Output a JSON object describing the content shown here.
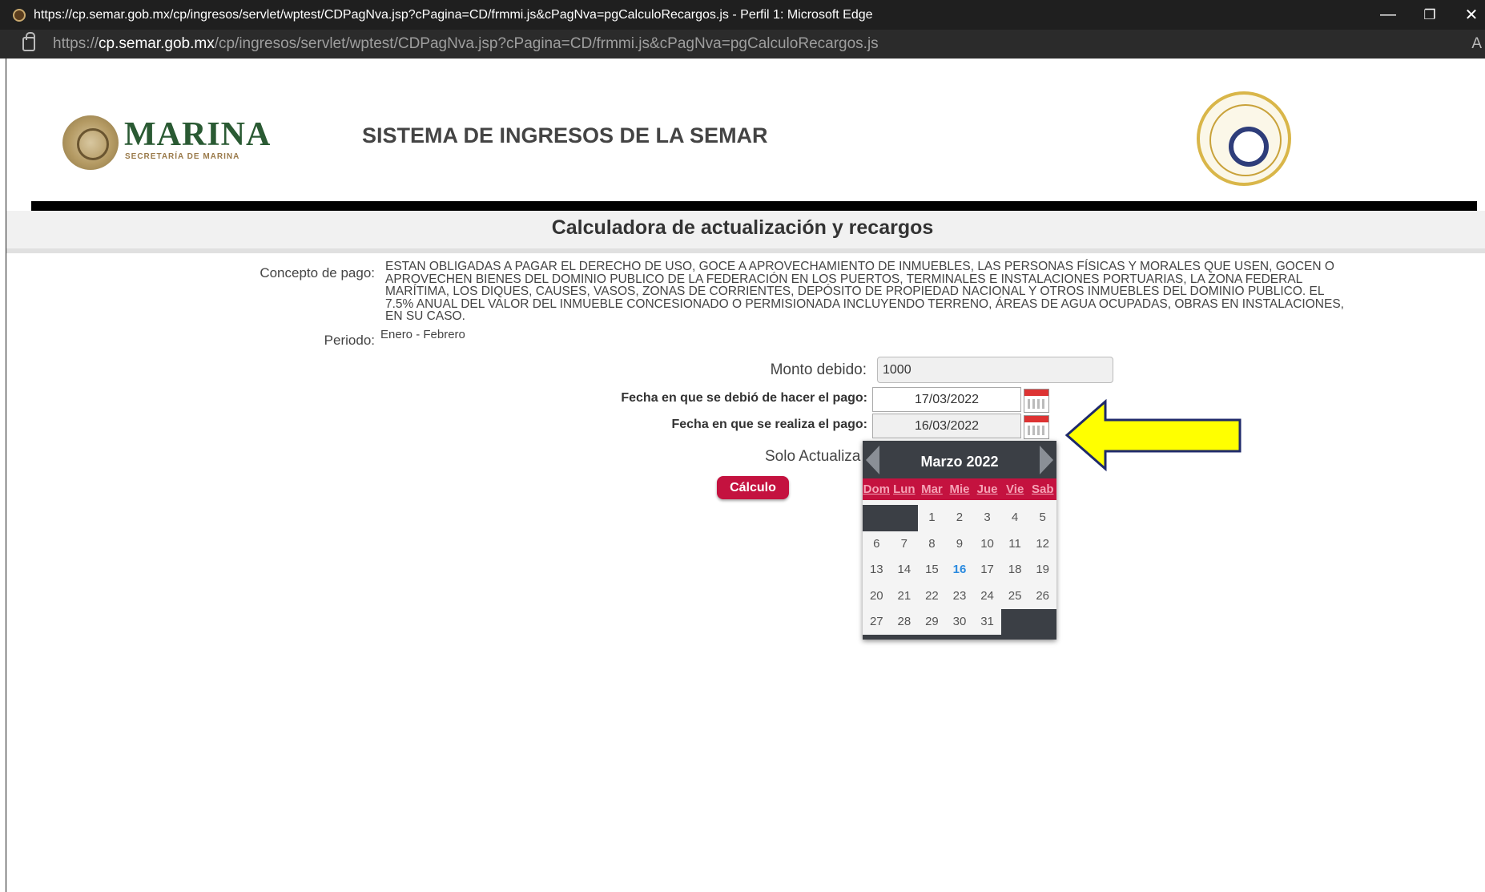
{
  "browser": {
    "window_title": "https://cp.semar.gob.mx/cp/ingresos/servlet/wptest/CDPagNva.jsp?cPagina=CD/frmmi.js&cPagNva=pgCalculoRecargos.js - Perfil 1: Microsoft Edge",
    "url_scheme": "https://",
    "url_host": "cp.semar.gob.mx",
    "url_path": "/cp/ingresos/servlet/wptest/CDPagNva.jsp?cPagina=CD/frmmi.js&cPagNva=pgCalculoRecargos.js",
    "reader_mode": "A",
    "minimize": "—",
    "restore": "❐",
    "close": "✕"
  },
  "header": {
    "brand": "MARINA",
    "brand_sub": "SECRETARÍA DE MARINA",
    "system_title": "SISTEMA DE INGRESOS DE LA SEMAR"
  },
  "page": {
    "title": "Calculadora de actualización y recargos"
  },
  "form": {
    "concepto_label": "Concepto de pago:",
    "concepto_lines": [
      "ESTAN OBLIGADAS A PAGAR EL DERECHO DE USO, GOCE A APROVECHAMIENTO DE INMUEBLES, LAS PERSONAS FÍSICAS Y MORALES QUE USEN, GOCEN O",
      "APROVECHEN BIENES DEL DOMINIO PUBLICO DE LA FEDERACIÓN EN LOS PUERTOS, TERMINALES E INSTALACIONES PORTUARIAS, LA ZONA FEDERAL",
      "MARÍTIMA, LOS DIQUES, CAUSES, VASOS, ZONAS DE CORRIENTES, DEPÓSITO DE PROPIEDAD NACIONAL Y OTROS INMUEBLES DEL DOMINIO PUBLICO. EL",
      "7.5% ANUAL DEL VALOR DEL INMUEBLE CONCESIONADO O PERMISIONADA INCLUYENDO TERRENO, ÁREAS DE AGUA OCUPADAS, OBRAS EN INSTALACIONES,",
      "EN SU CASO."
    ],
    "periodo_label": "Periodo:",
    "periodo_value": "Enero - Febrero",
    "monto_label": "Monto debido:",
    "monto_value": "1000",
    "fecha_debio_label": "Fecha en que se debió de hacer el pago:",
    "fecha_debio_value": "17/03/2022",
    "fecha_realiza_label": "Fecha en que se realiza el pago:",
    "fecha_realiza_value": "16/03/2022",
    "solo_label": "Solo Actualiza",
    "calculo_button": "Cálculo"
  },
  "calendar": {
    "month": "Marzo",
    "year": "2022",
    "weekdays": [
      "Dom",
      "Lun",
      "Mar",
      "Mie",
      "Jue",
      "Vie",
      "Sab"
    ],
    "weeks": [
      [
        "",
        "",
        "1",
        "2",
        "3",
        "4",
        "5"
      ],
      [
        "6",
        "7",
        "8",
        "9",
        "10",
        "11",
        "12"
      ],
      [
        "13",
        "14",
        "15",
        "16",
        "17",
        "18",
        "19"
      ],
      [
        "20",
        "21",
        "22",
        "23",
        "24",
        "25",
        "26"
      ],
      [
        "27",
        "28",
        "29",
        "30",
        "31",
        "",
        ""
      ]
    ],
    "selected_day": "16"
  },
  "colors": {
    "accent": "#c4123f",
    "calendar_dark": "#3b3f45",
    "arrow": "#ffff00",
    "arrow_outline": "#1f2a6b",
    "brand_green": "#2a5a33"
  },
  "icons": {
    "favicon": "site-favicon",
    "lock": "lock-icon",
    "calendar": "calendar-icon",
    "arrow": "left-arrow-annotation"
  }
}
